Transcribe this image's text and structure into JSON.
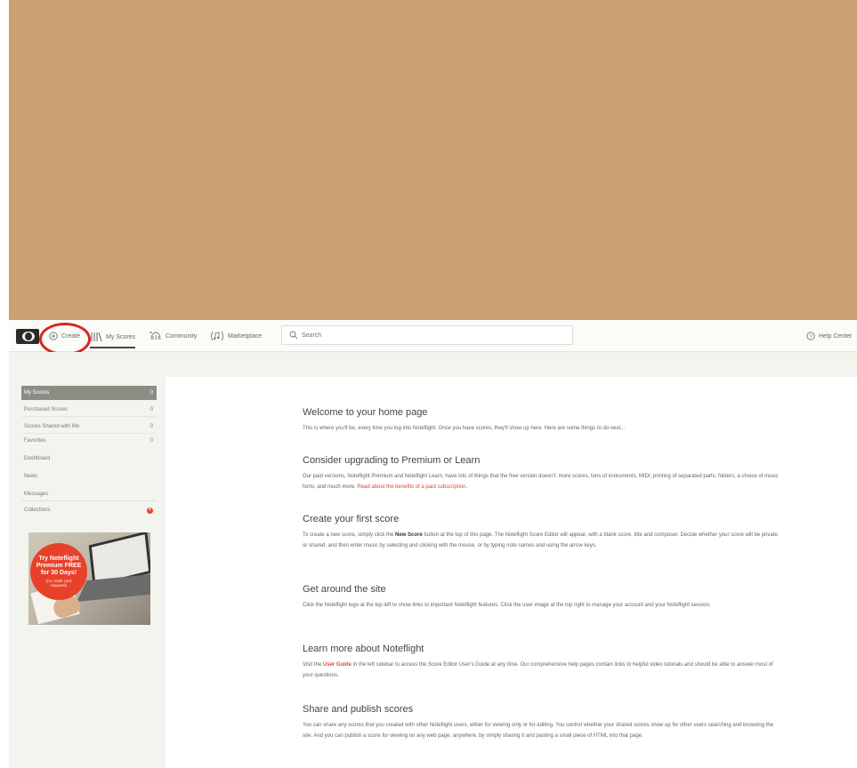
{
  "banner": {
    "color": "#cba274"
  },
  "nav": {
    "create": "Create",
    "my_scores": "My Scores",
    "community": "Community",
    "marketplace": "Marketplace",
    "search_placeholder": "Search",
    "help": "Help Center"
  },
  "sidebar": {
    "items": [
      {
        "label": "My Scores",
        "count": "0"
      },
      {
        "label": "Purchased Scores",
        "count": "0"
      },
      {
        "label": "Scores Shared with Me",
        "count": "0"
      },
      {
        "label": "Favorites",
        "count": "0"
      },
      {
        "label": "Dashboard"
      },
      {
        "label": "News"
      },
      {
        "label": "Messages"
      },
      {
        "label": "Collections",
        "badge": "+"
      }
    ]
  },
  "promo": {
    "line1": "Try Noteflight",
    "line2": "Premium FREE",
    "line3": "for 30 Days!",
    "line4": "(no credit card",
    "line5": "required)"
  },
  "sections": {
    "welcome": {
      "title": "Welcome to your home page",
      "body": "This is where you'll be, every time you log into Noteflight. Once you have scores, they'll show up here. Here are some things to do next..."
    },
    "upgrade": {
      "title": "Consider upgrading to Premium or Learn",
      "body": "Our paid versions, Noteflight Premium and Noteflight Learn, have lots of things that the free version doesn't: more scores, tons of instruments, MIDI, printing of separated parts, folders, a choice of music fonts, and much more. ",
      "link": "Read about the benefits of a paid subscription."
    },
    "create": {
      "title": "Create your first score",
      "body_a": "To create a new score, simply click the ",
      "bold": "New Score",
      "body_b": " button at the top of this page. The Noteflight Score Editor will appear, with a blank score, title and composer. Decide whether your score will be private or shared, and then enter music by selecting and clicking with the mouse, or by typing note names and using the arrow keys."
    },
    "around": {
      "title": "Get around the site",
      "body": "Click the Noteflight logo at the top left to show links to important Noteflight features. Click the user image at the top right to manage your account and your Noteflight session."
    },
    "learn": {
      "title": "Learn more about Noteflight",
      "body_a": "Visit the ",
      "bold": "User Guide",
      "body_b": " in the left sidebar to access the Score Editor User's Guide at any time. Our comprehensive help pages contain links to helpful video tutorials and should be able to answer most of your questions."
    },
    "share": {
      "title": "Share and publish scores",
      "body": "You can share any scores that you created with other Noteflight users, either for viewing only or for editing. You control whether your shared scores show up for other users searching and browsing the site. And you can publish a score for viewing on any web page, anywhere, by simply sharing it and pasting a small piece of HTML into that page."
    }
  }
}
